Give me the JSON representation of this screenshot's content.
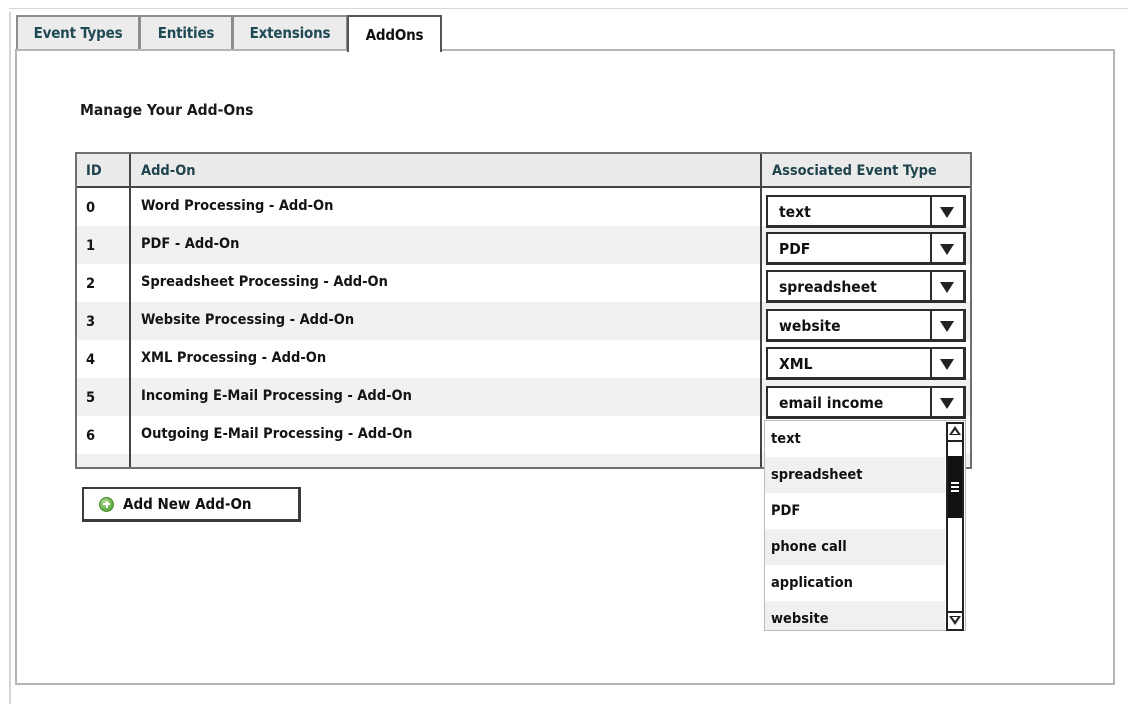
{
  "tabs": [
    {
      "label": "Event Types",
      "active": false
    },
    {
      "label": "Entities",
      "active": false
    },
    {
      "label": "Extensions",
      "active": false
    },
    {
      "label": "AddOns",
      "active": true
    }
  ],
  "section_title": "Manage Your Add-Ons",
  "table": {
    "columns": [
      "ID",
      "Add-On",
      "Associated Event Type"
    ],
    "rows": [
      {
        "id": "0",
        "addon": "Word Processing - Add-On",
        "event_type": "text"
      },
      {
        "id": "1",
        "addon": "PDF - Add-On",
        "event_type": "PDF"
      },
      {
        "id": "2",
        "addon": "Spreadsheet Processing - Add-On",
        "event_type": "spreadsheet"
      },
      {
        "id": "3",
        "addon": "Website Processing - Add-On",
        "event_type": "website"
      },
      {
        "id": "4",
        "addon": "XML Processing - Add-On",
        "event_type": "XML"
      },
      {
        "id": "5",
        "addon": "Incoming E-Mail Processing - Add-On",
        "event_type": "email income"
      },
      {
        "id": "6",
        "addon": "Outgoing E-Mail Processing - Add-On",
        "event_type": ""
      }
    ]
  },
  "dropdown": {
    "open_for_row": "6",
    "options": [
      "text",
      "spreadsheet",
      "PDF",
      "phone call",
      "application",
      "website"
    ]
  },
  "add_button": {
    "label": "Add New Add-On",
    "icon": "plus-circle-icon"
  },
  "icons": {
    "select_arrow": "triangle-down-icon",
    "scroll_up": "scroll-up-arrow-icon",
    "scroll_down": "scroll-down-arrow-icon"
  },
  "colors": {
    "tab_text": "#1f4a55",
    "header_text": "#20444e",
    "add_icon_green": "#5aa63a"
  }
}
